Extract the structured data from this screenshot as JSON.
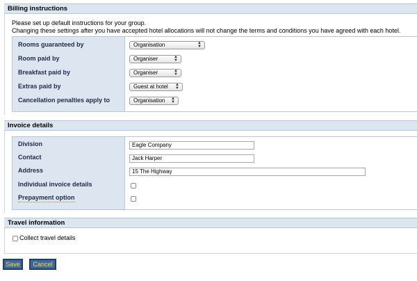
{
  "billing": {
    "title": "Billing instructions",
    "intro_line1": "Please set up default instructions for your group.",
    "intro_line2": "Changing these settings after you have accepted hotel allocations will not change the terms and conditions you have agreed with each hotel.",
    "rows": [
      {
        "label": "Rooms guaranteed by",
        "value": "Organisation"
      },
      {
        "label": "Room paid by",
        "value": "Organiser"
      },
      {
        "label": "Breakfast paid by",
        "value": "Organiser"
      },
      {
        "label": "Extras paid by",
        "value": "Guest at hotel"
      },
      {
        "label": "Cancellation penalties apply to",
        "value": "Organisation"
      }
    ]
  },
  "invoice": {
    "title": "Invoice details",
    "division_label": "Division",
    "division_value": "Eagle Company",
    "contact_label": "Contact",
    "contact_value": "Jack Harper",
    "address_label": "Address",
    "address_value": "15 The Highway",
    "individual_label": "Individual invoice details",
    "individual_checked": false,
    "prepayment_label": "Prepayment option",
    "prepayment_checked": false
  },
  "travel": {
    "title": "Travel information",
    "collect_label": "Collect travel details",
    "collect_checked": false
  },
  "actions": {
    "save_label": "Save",
    "cancel_label": "Cancel"
  },
  "colors": {
    "header_bg": "#dce6f1",
    "label_bg": "#dde6f0",
    "button_bg": "#3c6a9c",
    "button_text": "#ffd83a"
  }
}
